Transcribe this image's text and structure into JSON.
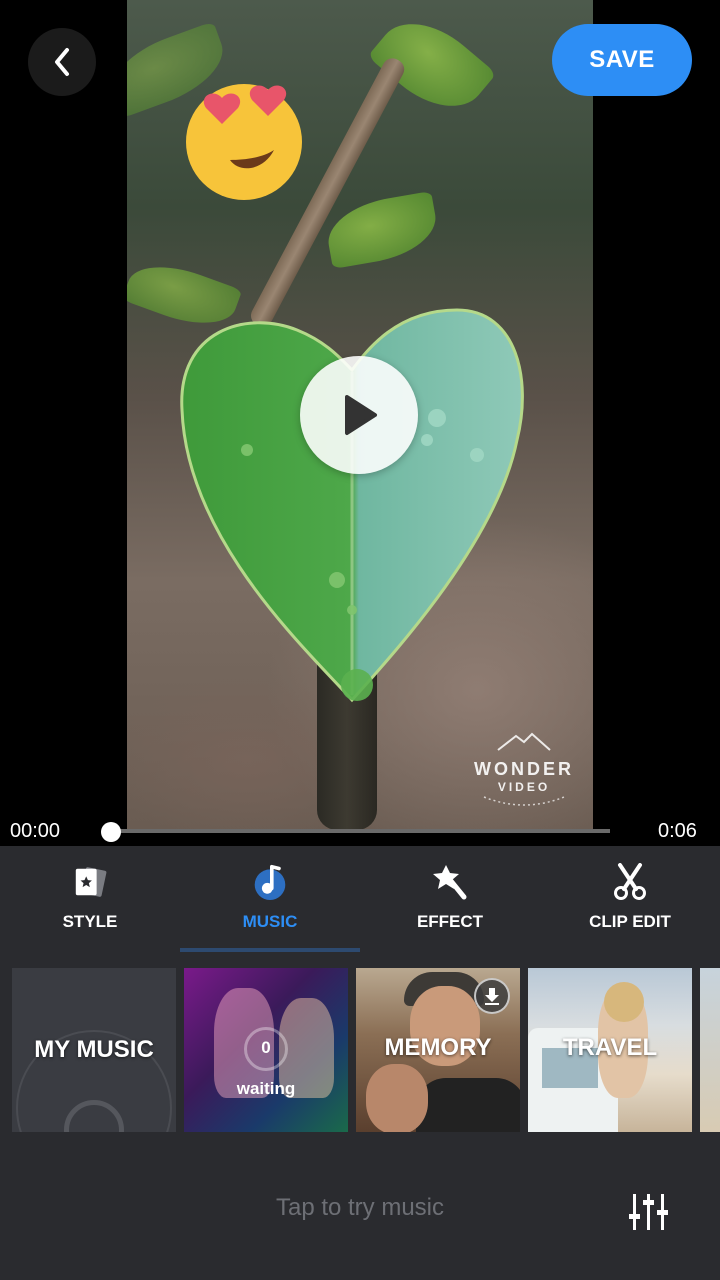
{
  "header": {
    "back_icon": "chevron-left-icon",
    "save_label": "SAVE",
    "save_color": "#2d8ef5"
  },
  "player": {
    "play_icon": "play-icon",
    "sticker": "heart-eyes-emoji",
    "watermark": {
      "title": "WONDER",
      "subtitle": "VIDEO",
      "close_icon": "close-icon",
      "close_color": "#f6b81c"
    }
  },
  "timeline": {
    "current": "00:00",
    "duration": "0:06",
    "progress": 0
  },
  "tabs": [
    {
      "label": "STYLE",
      "icon": "style-card-icon",
      "active": false
    },
    {
      "label": "MUSIC",
      "icon": "music-note-icon",
      "active": true
    },
    {
      "label": "EFFECT",
      "icon": "magic-wand-icon",
      "active": false
    },
    {
      "label": "CLIP EDIT",
      "icon": "scissors-icon",
      "active": false
    }
  ],
  "music_cards": {
    "my_music": "MY MUSIC",
    "party": {
      "count": "0",
      "status": "waiting"
    },
    "memory": {
      "label": "MEMORY",
      "icon": "download-icon"
    },
    "travel": {
      "label": "TRAVEL"
    }
  },
  "footer": {
    "hint": "Tap to try music",
    "mixer_icon": "equalizer-sliders-icon"
  },
  "colors": {
    "accent": "#2d8ef5",
    "panel_bg": "#2a2b2f",
    "tab_indicator": "#2d4a70"
  }
}
